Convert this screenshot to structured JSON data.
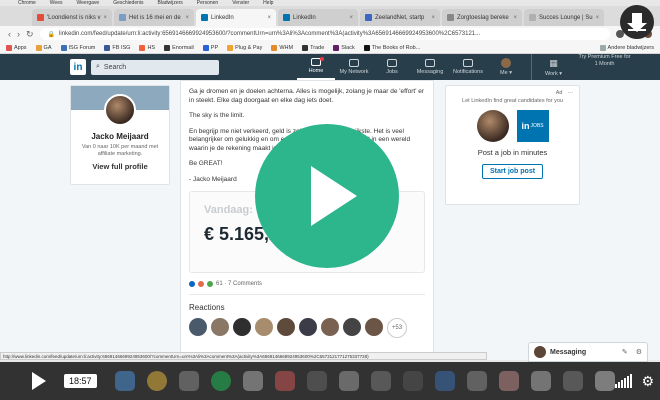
{
  "menubar": [
    "Chrome",
    "Wees",
    "Weergave",
    "Geschiedenis",
    "Bladwijzers",
    "Personen",
    "Venster",
    "Help"
  ],
  "tabs": [
    {
      "label": "'Loondienst is niks v",
      "color": "#e34b3b",
      "active": false
    },
    {
      "label": "Het is 16 mei en de",
      "color": "#7a9cc6",
      "active": false
    },
    {
      "label": "LinkedIn",
      "color": "#0073b1",
      "active": true
    },
    {
      "label": "LinkedIn",
      "color": "#0073b1",
      "active": false
    },
    {
      "label": "ZeelandNet, startp",
      "color": "#3b66c4",
      "active": false
    },
    {
      "label": "Zorgtoeslag bereke",
      "color": "#888888",
      "active": false
    },
    {
      "label": "Succes Lounge | Su",
      "color": "#b0b0b0",
      "active": false
    }
  ],
  "address": {
    "url": "linkedin.com/feed/update/urn:li:activity:6569146669924953600/?commentUrn=urn%3Ali%3Acomment%3A(activity%3A6569146669924953600%2C6573121..."
  },
  "bookmarks": [
    {
      "label": "Apps",
      "color": "#d55"
    },
    {
      "label": "GA",
      "color": "#e9a23b"
    },
    {
      "label": "ISG Forum",
      "color": "#3b6fb6"
    },
    {
      "label": "FB ISG",
      "color": "#3b5998"
    },
    {
      "label": "HS",
      "color": "#f0623b"
    },
    {
      "label": "Enormail",
      "color": "#333"
    },
    {
      "label": "PP",
      "color": "#2a61d6"
    },
    {
      "label": "Plug & Pay",
      "color": "#f2a134"
    },
    {
      "label": "WHM",
      "color": "#e58a2d"
    },
    {
      "label": "Trade",
      "color": "#333"
    },
    {
      "label": "Slack",
      "color": "#611f69"
    },
    {
      "label": "The Books of Rob...",
      "color": "#111"
    }
  ],
  "bookmarks_right": "Andere bladwijzers",
  "nav": {
    "logo": "in",
    "search_placeholder": "Search",
    "items": [
      {
        "label": "Home",
        "active": true
      },
      {
        "label": "My Network",
        "active": false
      },
      {
        "label": "Jobs",
        "active": false
      },
      {
        "label": "Messaging",
        "active": false
      },
      {
        "label": "Notifications",
        "active": false
      }
    ],
    "me": "Me ▾",
    "work": "Work ▾",
    "premium": "Try Premium Free for 1 Month"
  },
  "profile": {
    "name": "Jacko Meijaard",
    "headline": "Van 0 naar 10K per maand met affiliate marketing.",
    "link": "View full profile"
  },
  "post": {
    "paragraphs": [
      "Ga je dromen en je doelen achterna. Alles is mogelijk, zolang je maar de 'effort' er in steekt. Elke dag doorgaat en elke dag iets doet.",
      "The sky is the limit.",
      "En begrijp me niet verkeerd, geld is zeker niet het belangrijkste. Het is veel belangrijker om gelukkig en om er voor je omgeving eens maal in een wereld waarin je de rekening maakt in een kan doen voor hartjes.",
      "Be GREAT!",
      "- Jacko Meijaard"
    ]
  },
  "stat": {
    "label": "Vandaag:",
    "value": "€ 5.165,2"
  },
  "social": {
    "counts": "61 · 7 Comments"
  },
  "reactions": {
    "title": "Reactions",
    "more": "+53"
  },
  "ad": {
    "tag": "Ad",
    "menu": "···",
    "text": "Let LinkedIn find great candidates for you",
    "jobs_logo": "in",
    "jobs_word": "JOBS",
    "title": "Post a job in minutes",
    "button": "Start job post"
  },
  "status_url": "http://www.linkedin.com/feed/update/urn:li:activity:6569146669924953600/?commentUrn=urn%3Ali%3Acomment%3A(activity%3A6569146669924953600%2C6573121771275337728)",
  "messaging": {
    "label": "Messaging"
  },
  "video": {
    "time": "18:57"
  }
}
